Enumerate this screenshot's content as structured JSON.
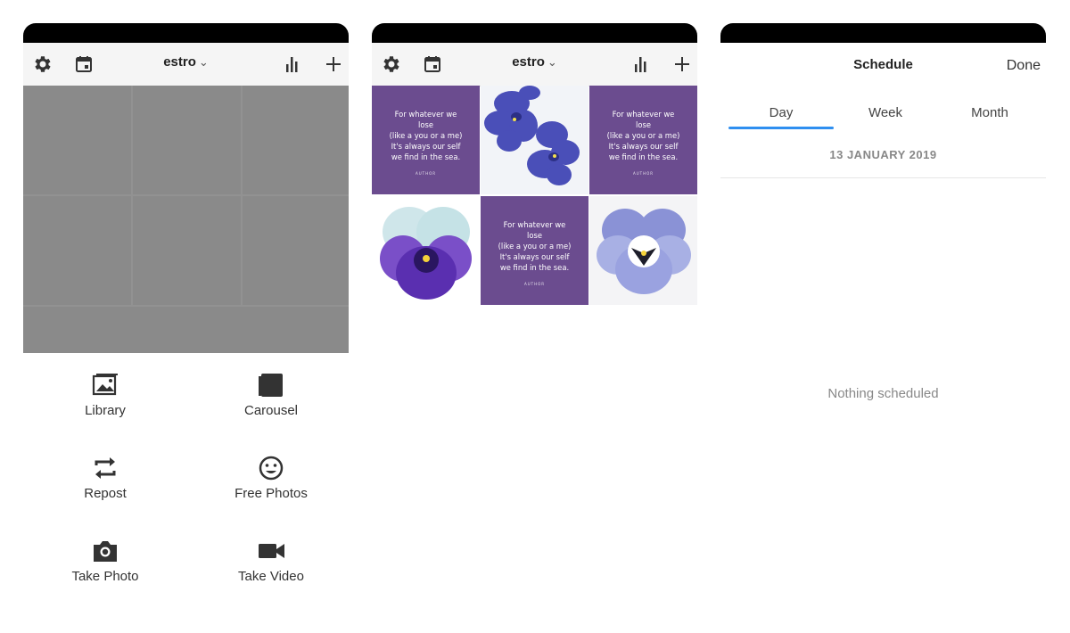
{
  "screen1": {
    "account": "estro",
    "actions": [
      {
        "label": "Library",
        "icon": "library-icon"
      },
      {
        "label": "Carousel",
        "icon": "carousel-icon"
      },
      {
        "label": "Repost",
        "icon": "repost-icon"
      },
      {
        "label": "Free Photos",
        "icon": "smiley-icon"
      },
      {
        "label": "Take Photo",
        "icon": "camera-icon"
      },
      {
        "label": "Take Video",
        "icon": "video-camera-icon"
      }
    ]
  },
  "screen2": {
    "account": "estro",
    "quote": {
      "line1": "For whatever we",
      "line2": "lose",
      "line3": "(like a you or a me)",
      "line4": "It's always our self",
      "line5": "we find in the sea.",
      "author": "AUTHOR"
    }
  },
  "screen3": {
    "title": "Schedule",
    "done_label": "Done",
    "tabs": [
      "Day",
      "Week",
      "Month"
    ],
    "active_tab": "Day",
    "date": "13 JANUARY 2019",
    "empty_message": "Nothing scheduled"
  },
  "colors": {
    "quote_bg": "#6b4c8f",
    "tab_indicator": "#2f8ff0",
    "overlay": "#8a8a8a"
  }
}
